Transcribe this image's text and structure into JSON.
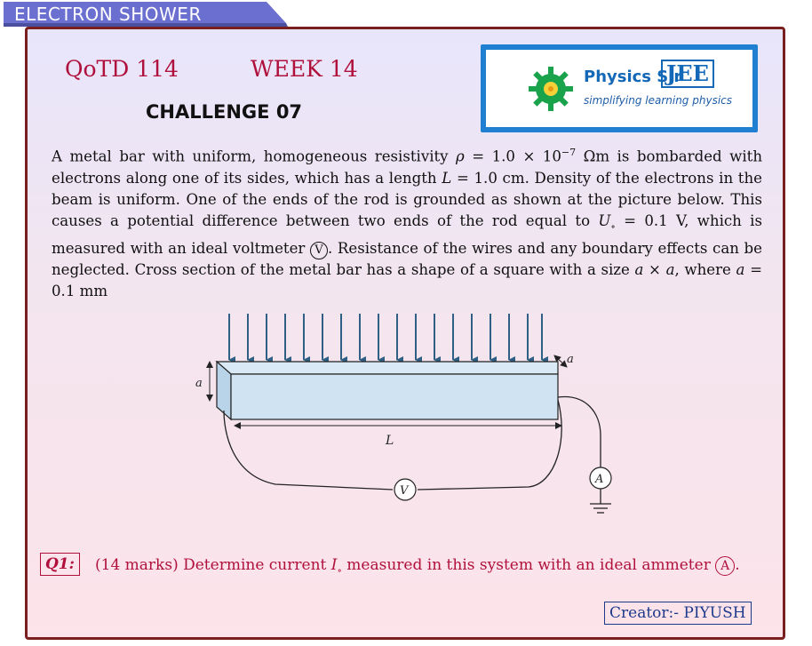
{
  "header": {
    "tab_label": "ELECTRON SHOWER"
  },
  "title": {
    "qotd": "QoTD 114",
    "week": "WEEK 14",
    "challenge": "CHALLENGE 07"
  },
  "logo": {
    "title": "Physics Sir",
    "jee": "JEE",
    "tagline": "simplifying learning physics",
    "icon": "gear-icon"
  },
  "problem": {
    "t1": "A metal bar with uniform, homogeneous resistivity ",
    "rho": "ρ",
    "t2": " = 1.0 × 10",
    "exp": "−7",
    "t3": " Ωm is bombarded with electrons along one of its sides, which has a length ",
    "L": "L",
    "t4": " = 1.0 cm. Density of the electrons in the beam is uniform. One of the ends of the rod is grounded as shown at the picture below. This causes a potential difference between two ends of the rod equal to ",
    "U": "U",
    "Usub": "∘",
    "t5": " = 0.1 V, which is measured with an ideal voltmeter ",
    "vsym": "V",
    "t6": ". Resistance of the wires and any boundary effects can be neglected. Cross section of the metal bar has a shape of a square with a size ",
    "axa": "a × a",
    "t7": ", where ",
    "a": "a",
    "t8": " = 0.1 mm"
  },
  "diagram": {
    "label_a_left": "a",
    "label_a_right": "a",
    "label_L": "L",
    "voltmeter": "V",
    "ammeter": "A"
  },
  "question": {
    "label": "Q1:",
    "t1": "(14 marks) Determine current ",
    "I": "I",
    "Isub": "∘",
    "t2": " measured in this system with an ideal ammeter ",
    "asym": "A",
    "t3": "."
  },
  "creator": "Creator:- PIYUSH",
  "colors": {
    "accent": "#b0103c",
    "tab": "#6b6fcf",
    "border": "#7a1f1f",
    "bar": "#cfe3f2",
    "arrow": "#2f5f85"
  }
}
